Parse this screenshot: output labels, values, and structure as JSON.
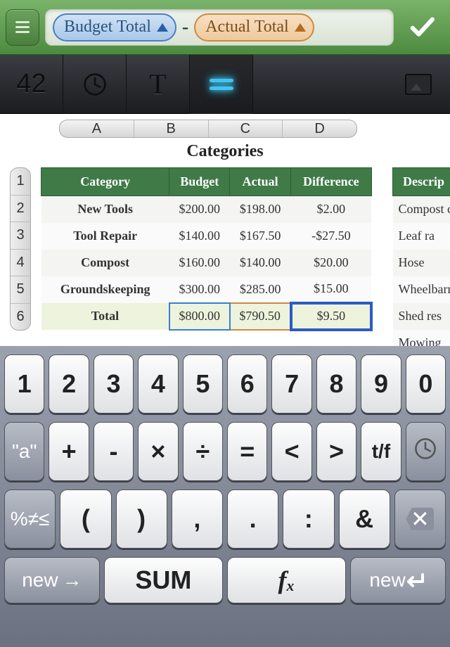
{
  "formula": {
    "pill1_label": "Budget Total",
    "pill2_label": "Actual Total",
    "operator": "-"
  },
  "toolbar": {
    "num_glyph": "42",
    "text_glyph": "T"
  },
  "sheet": {
    "columns": [
      "A",
      "B",
      "C",
      "D"
    ],
    "row_numbers": [
      "1",
      "2",
      "3",
      "4",
      "5",
      "6"
    ],
    "title": "Categories",
    "headers": [
      "Category",
      "Budget",
      "Actual",
      "Difference"
    ],
    "rows": [
      {
        "cat": "New Tools",
        "b": "$200.00",
        "a": "$198.00",
        "d": "$2.00"
      },
      {
        "cat": "Tool Repair",
        "b": "$140.00",
        "a": "$167.50",
        "d": "-$27.50"
      },
      {
        "cat": "Compost",
        "b": "$160.00",
        "a": "$140.00",
        "d": "$20.00"
      },
      {
        "cat": "Groundskeeping",
        "b": "$300.00",
        "a": "$285.00",
        "d": "$15.00"
      }
    ],
    "total_row": {
      "cat": "Total",
      "b": "$800.00",
      "a": "$790.50",
      "d": "$9.50"
    },
    "side_header": "Descrip",
    "side_rows": [
      "Compost c",
      "Leaf ra",
      "Hose",
      "Wheelbarro",
      "Shed res",
      "Mowing"
    ]
  },
  "keyboard": {
    "r1": [
      "1",
      "2",
      "3",
      "4",
      "5",
      "6",
      "7",
      "8",
      "9",
      "0"
    ],
    "r2": [
      "\"a\"",
      "+",
      "-",
      "×",
      "÷",
      "=",
      "<",
      ">",
      "t/f"
    ],
    "r3": [
      "%≠≤",
      "(",
      ")",
      ",",
      ".",
      ":",
      "&"
    ],
    "r4_new": "new",
    "r4_sum": "SUM",
    "r4_fx": "fₓ"
  }
}
